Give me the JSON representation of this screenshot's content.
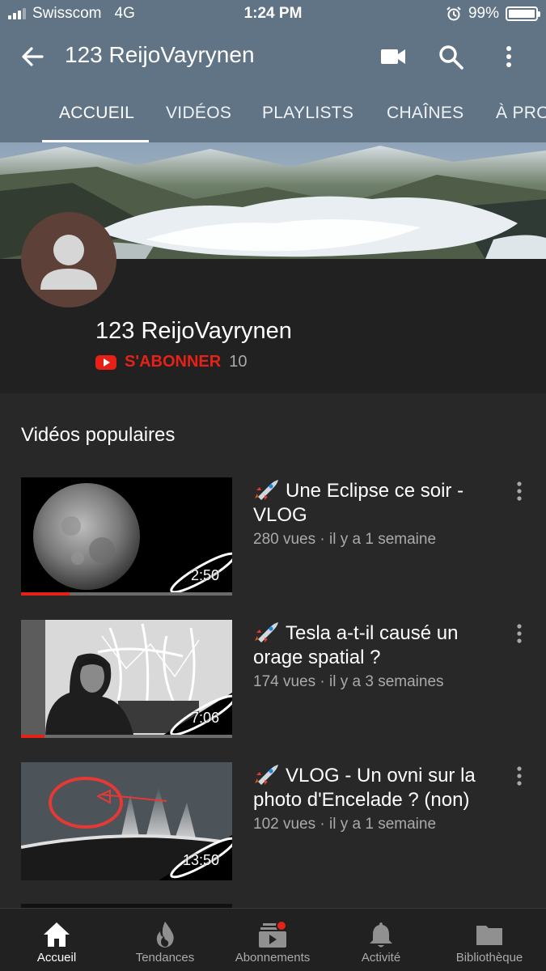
{
  "status_bar": {
    "carrier": "Swisscom",
    "network": "4G",
    "time": "1:24 PM",
    "battery": "99%",
    "icons": [
      "signal-icon",
      "alarm-icon",
      "battery-icon"
    ]
  },
  "app_bar": {
    "title": "123 ReijoVayrynen",
    "icons": [
      "back-arrow-icon",
      "video-camera-icon",
      "search-icon",
      "more-vert-icon"
    ]
  },
  "tabs": [
    {
      "label": "ACCUEIL",
      "active": true
    },
    {
      "label": "VIDÉOS",
      "active": false
    },
    {
      "label": "PLAYLISTS",
      "active": false
    },
    {
      "label": "CHAÎNES",
      "active": false
    },
    {
      "label": "À PRO",
      "active": false
    }
  ],
  "channel": {
    "name": "123 ReijoVayrynen",
    "subscribe_label": "S'ABONNER",
    "subscriber_count": "10"
  },
  "section": {
    "title": "Vidéos populaires"
  },
  "videos": [
    {
      "title": "Une Eclipse ce soir - VLOG",
      "meta": "280 vues · il y a 1 semaine",
      "duration": "2:50",
      "watched_fraction": 0.23
    },
    {
      "title": "Tesla a-t-il causé un orage spatial ?",
      "meta": "174 vues · il y a 3 semaines",
      "duration": "7:06",
      "watched_fraction": 0.11
    },
    {
      "title": "VLOG - Un ovni sur la photo d'Encelade ? (non)",
      "meta": "102 vues · il y a 1 semaine",
      "duration": "13:50",
      "watched_fraction": 0
    }
  ],
  "bottom_nav": [
    {
      "label": "Accueil",
      "icon": "home-icon",
      "active": true
    },
    {
      "label": "Tendances",
      "icon": "flame-icon",
      "active": false
    },
    {
      "label": "Abonnements",
      "icon": "subscriptions-icon",
      "active": false
    },
    {
      "label": "Activité",
      "icon": "bell-icon",
      "active": false
    },
    {
      "label": "Bibliothèque",
      "icon": "folder-icon",
      "active": false
    }
  ],
  "colors": {
    "header_bg": "#617486",
    "accent_red": "#e62117",
    "page_bg": "#212121",
    "section_bg": "#282828"
  }
}
